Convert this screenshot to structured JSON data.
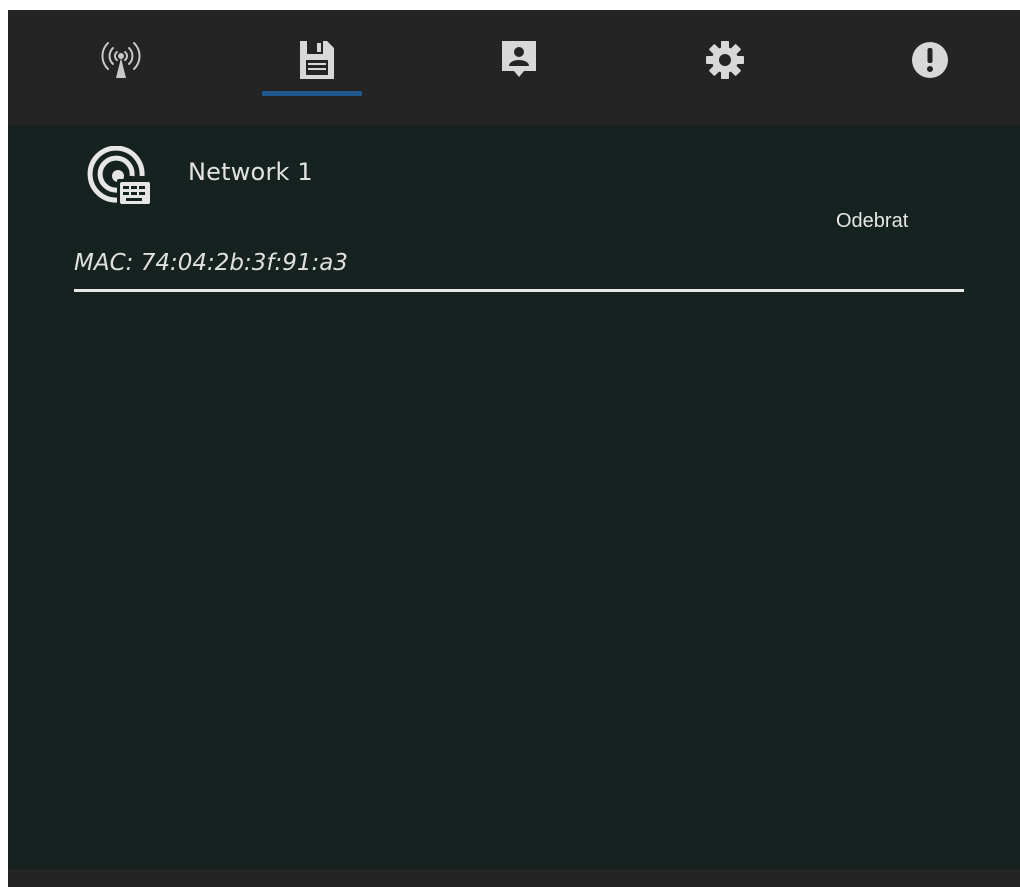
{
  "tabs": [
    {
      "id": "networks",
      "icon": "wifi-antenna-icon",
      "active": false
    },
    {
      "id": "saved",
      "icon": "floppy-disk-icon",
      "active": true
    },
    {
      "id": "profile",
      "icon": "contact-card-icon",
      "active": false
    },
    {
      "id": "settings",
      "icon": "gear-icon",
      "active": false
    },
    {
      "id": "info",
      "icon": "alert-circle-icon",
      "active": false
    }
  ],
  "saved_network": {
    "icon": "network-settings-icon",
    "name": "Network 1",
    "mac": "MAC: 74:04:2b:3f:91:a3",
    "remove_label": "Odebrat"
  },
  "colors": {
    "tabbar_bg": "#242424",
    "content_bg": "#162220",
    "active_indicator": "#1f5a8f",
    "text": "#e2e2e2"
  }
}
